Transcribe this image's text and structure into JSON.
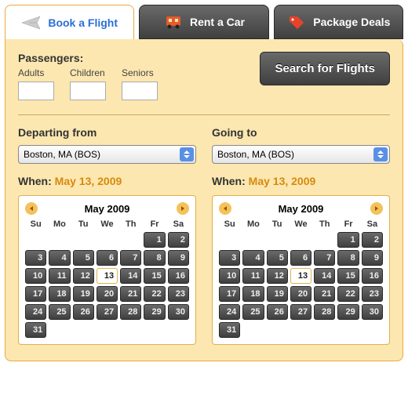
{
  "tabs": {
    "flight": "Book a Flight",
    "car": "Rent a Car",
    "package": "Package Deals"
  },
  "passengers": {
    "title": "Passengers:",
    "adults": "Adults",
    "children": "Children",
    "seniors": "Seniors"
  },
  "search_label": "Search for Flights",
  "depart": {
    "label": "Departing from",
    "value": "Boston, MA (BOS)",
    "when_label": "When:",
    "when_date": "May 13, 2009"
  },
  "going": {
    "label": "Going to",
    "value": "Boston, MA (BOS)",
    "when_label": "When:",
    "when_date": "May 13, 2009"
  },
  "calendar": {
    "title": "May 2009",
    "dow": [
      "Su",
      "Mo",
      "Tu",
      "We",
      "Th",
      "Fr",
      "Sa"
    ],
    "blanks": 5,
    "days": 31,
    "selected": 13
  }
}
